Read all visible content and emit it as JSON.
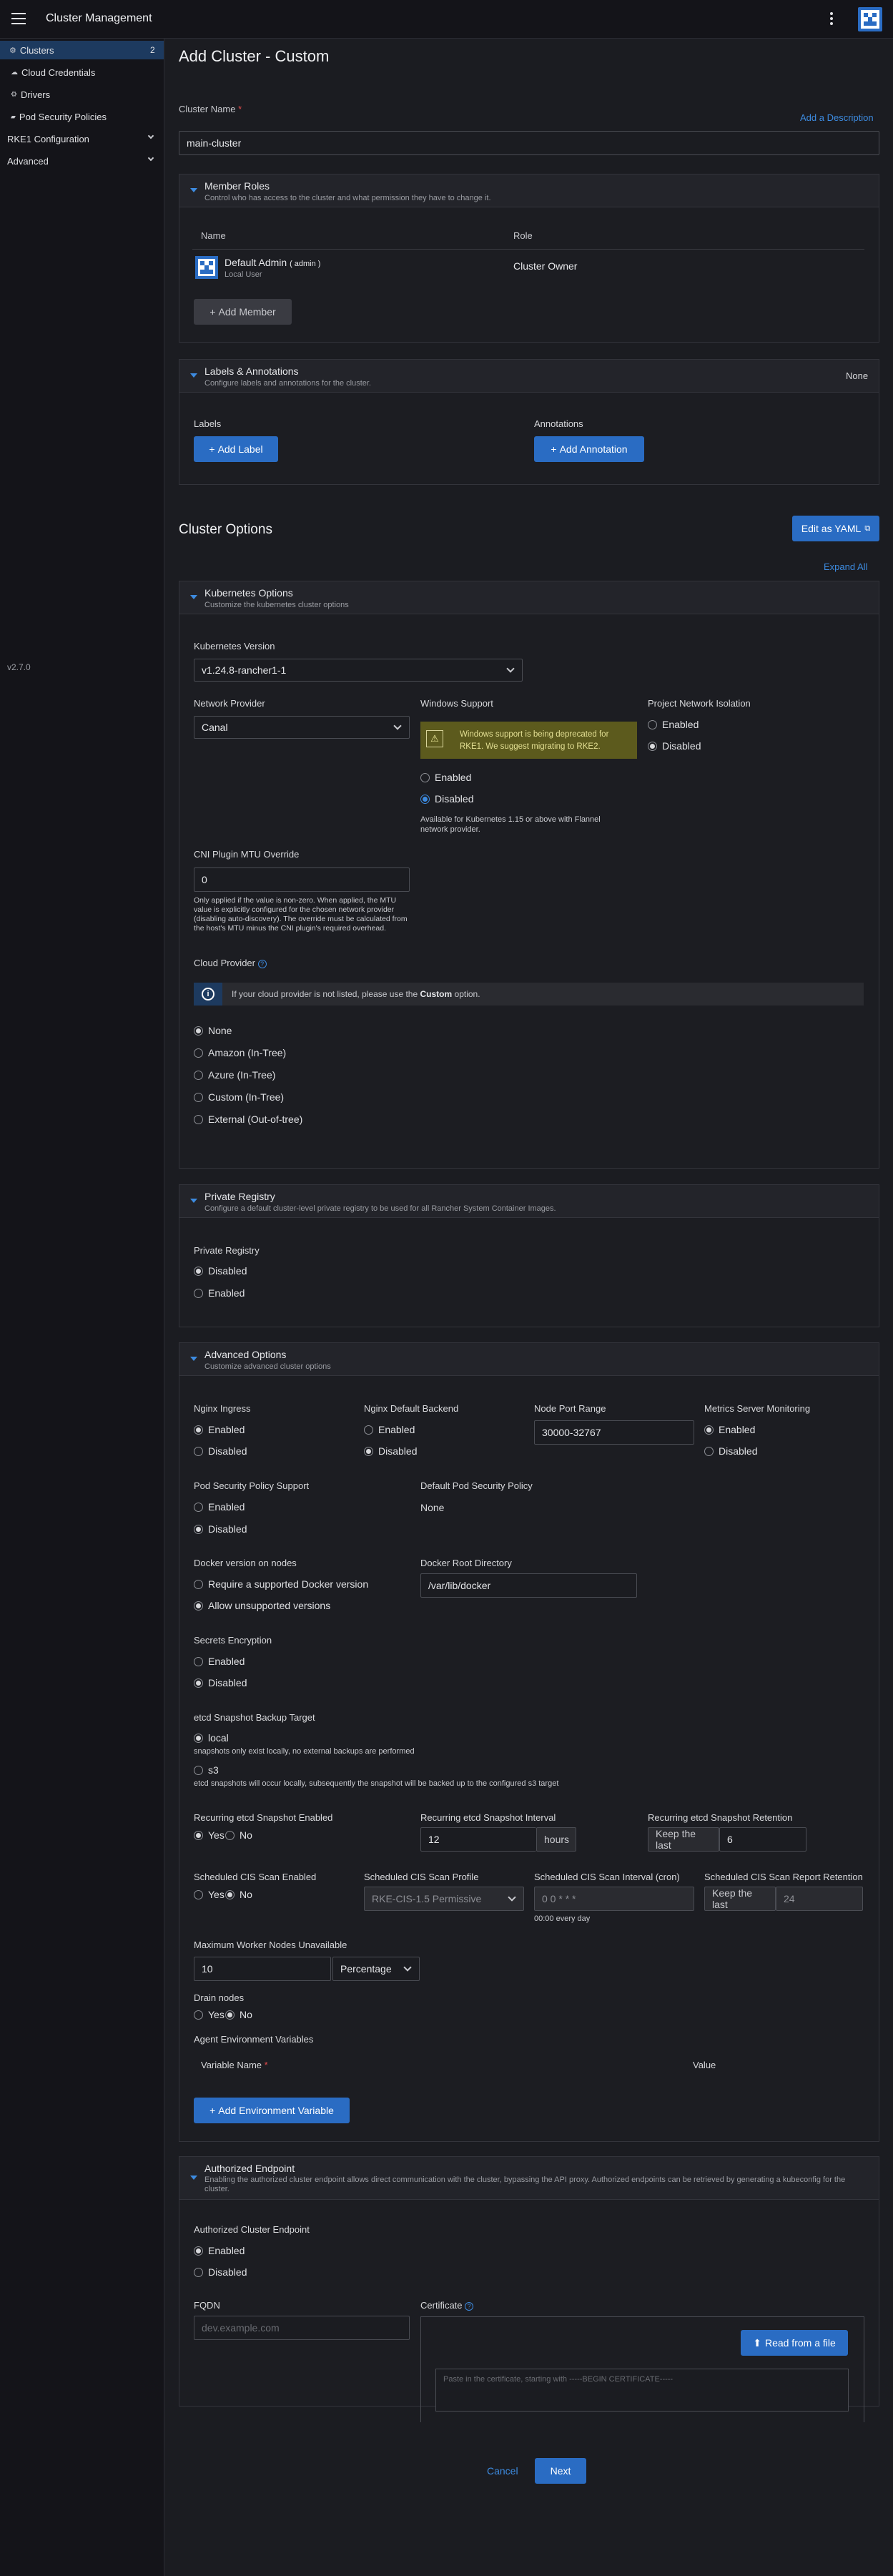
{
  "header": {
    "title": "Cluster Management"
  },
  "sidebar": {
    "items": [
      {
        "label": "Clusters",
        "badge": "2"
      },
      {
        "label": "Cloud Credentials"
      },
      {
        "label": "Drivers"
      },
      {
        "label": "Pod Security Policies"
      }
    ],
    "groups": [
      "RKE1 Configuration",
      "Advanced"
    ],
    "version": "v2.7.0"
  },
  "page": {
    "title": "Add Cluster - Custom",
    "cluster_name_label": "Cluster Name",
    "cluster_name_value": "main-cluster",
    "add_description": "Add a Description"
  },
  "member_roles": {
    "title": "Member Roles",
    "subtitle": "Control who has access to the cluster and what permission they have to change it.",
    "col_name": "Name",
    "col_role": "Role",
    "member_name": "Default Admin",
    "member_tag": "( admin )",
    "member_sub": "Local User",
    "member_role": "Cluster Owner",
    "add_member": "Add Member"
  },
  "labels": {
    "title": "Labels & Annotations",
    "subtitle": "Configure labels and annotations for the cluster.",
    "none": "None",
    "labels_label": "Labels",
    "add_label": "Add Label",
    "annotations_label": "Annotations",
    "add_annotation": "Add Annotation"
  },
  "cluster_options": {
    "title": "Cluster Options",
    "edit_yaml": "Edit as YAML",
    "expand_all": "Expand All"
  },
  "k8s": {
    "title": "Kubernetes Options",
    "subtitle": "Customize the kubernetes cluster options",
    "version_label": "Kubernetes Version",
    "version_value": "v1.24.8-rancher1-1",
    "network_label": "Network Provider",
    "network_value": "Canal",
    "windows_label": "Windows Support",
    "windows_warning": "Windows support is being deprecated for RKE1. We suggest migrating to RKE2.",
    "windows_enabled": "Enabled",
    "windows_disabled": "Disabled",
    "windows_note": "Available for Kubernetes 1.15 or above with Flannel network provider.",
    "pni_label": "Project Network Isolation",
    "pni_enabled": "Enabled",
    "pni_disabled": "Disabled",
    "mtu_label": "CNI Plugin MTU Override",
    "mtu_value": "0",
    "mtu_note": "Only applied if the value is non-zero. When applied, the MTU value is explicitly configured for the chosen network provider (disabling auto-discovery). The override must be calculated from the host's MTU minus the CNI plugin's required overhead.",
    "cloud_label": "Cloud Provider",
    "cloud_info": "If your cloud provider is not listed, please use the",
    "cloud_info_bold": "Custom",
    "cloud_info_end": "option.",
    "cloud_options": [
      "None",
      "Amazon (In-Tree)",
      "Azure (In-Tree)",
      "Custom (In-Tree)",
      "External (Out-of-tree)"
    ]
  },
  "registry": {
    "title": "Private Registry",
    "subtitle": "Configure a default cluster-level private registry to be used for all Rancher System Container Images.",
    "label": "Private Registry",
    "disabled": "Disabled",
    "enabled": "Enabled"
  },
  "advanced": {
    "title": "Advanced Options",
    "subtitle": "Customize advanced cluster options",
    "nginx_label": "Nginx Ingress",
    "nginx_backend_label": "Nginx Default Backend",
    "node_port_label": "Node Port Range",
    "node_port_value": "30000-32767",
    "metrics_label": "Metrics Server Monitoring",
    "enabled": "Enabled",
    "disabled": "Disabled",
    "psp_label": "Pod Security Policy Support",
    "default_psp_label": "Default Pod Security Policy",
    "default_psp_value": "None",
    "docker_label": "Docker version on nodes",
    "docker_opt1": "Require a supported Docker version",
    "docker_opt2": "Allow unsupported versions",
    "docker_root_label": "Docker Root Directory",
    "docker_root_value": "/var/lib/docker",
    "secrets_label": "Secrets Encryption",
    "etcd_label": "etcd Snapshot Backup Target",
    "etcd_local": "local",
    "etcd_local_note": "snapshots only exist locally, no external backups are performed",
    "etcd_s3": "s3",
    "etcd_s3_note": "etcd snapshots will occur locally, subsequently the snapshot will be backed up to the configured s3 target",
    "recurring_label": "Recurring etcd Snapshot Enabled",
    "yes": "Yes",
    "no": "No",
    "interval_label": "Recurring etcd Snapshot Interval",
    "interval_value": "12",
    "interval_unit": "hours",
    "retention_label": "Recurring etcd Snapshot Retention",
    "keep_last": "Keep the last",
    "retention_value": "6",
    "cis_enabled_label": "Scheduled CIS Scan Enabled",
    "cis_profile_label": "Scheduled CIS Scan Profile",
    "cis_profile_value": "RKE-CIS-1.5 Permissive",
    "cis_interval_label": "Scheduled CIS Scan Interval (cron)",
    "cis_interval_value": "0 0 * * *",
    "cis_interval_note": "00:00 every day",
    "cis_retention_label": "Scheduled CIS Scan Report Retention",
    "cis_retention_value": "24",
    "max_unavail_label": "Maximum Worker Nodes Unavailable",
    "max_unavail_value": "10",
    "max_unavail_unit": "Percentage",
    "drain_label": "Drain nodes",
    "agent_env_label": "Agent Environment Variables",
    "var_name": "Variable Name",
    "value": "Value",
    "add_env": "Add Environment Variable"
  },
  "endpoint": {
    "title": "Authorized Endpoint",
    "subtitle": "Enabling the authorized cluster endpoint allows direct communication with the cluster, bypassing the API proxy. Authorized endpoints can be retrieved by generating a kubeconfig for the cluster.",
    "ace_label": "Authorized Cluster Endpoint",
    "enabled": "Enabled",
    "disabled": "Disabled",
    "fqdn_label": "FQDN",
    "fqdn_placeholder": "dev.example.com",
    "cert_label": "Certificate",
    "read_file": "Read from a file",
    "cert_placeholder": "Paste in the certificate, starting with -----BEGIN CERTIFICATE-----"
  },
  "footer": {
    "cancel": "Cancel",
    "next": "Next"
  },
  "colors": {
    "accent": "#2a6cc3",
    "link": "#3d8be0",
    "warning_bg": "#5c5a1d"
  }
}
